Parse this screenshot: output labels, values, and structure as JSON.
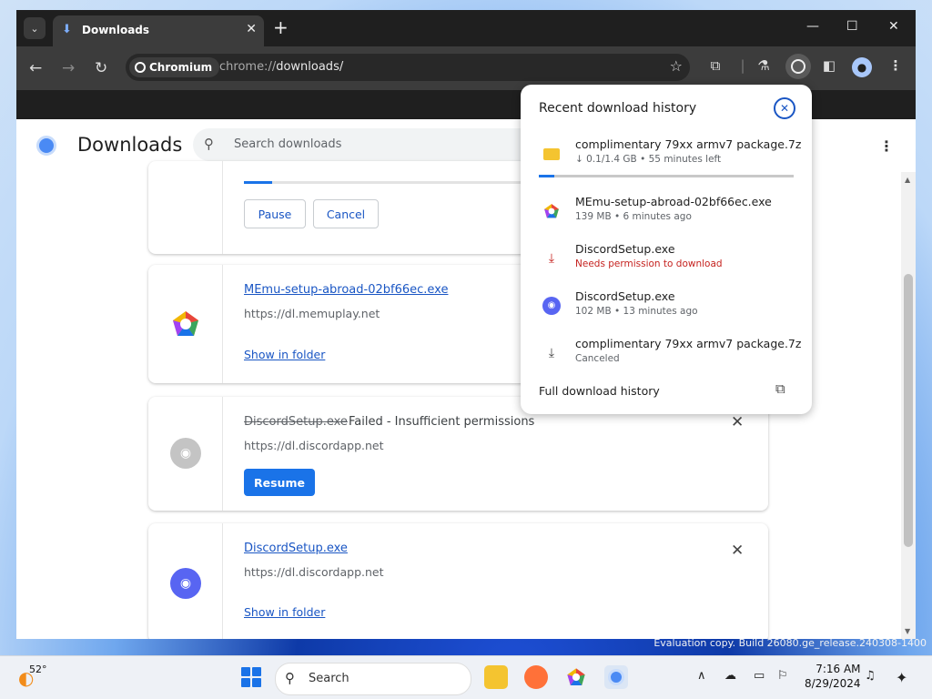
{
  "window": {
    "tab_title": "Downloads",
    "omnibox_chip": "Chromium",
    "url_scheme": "chrome://",
    "url_path": "downloads/"
  },
  "page": {
    "title": "Downloads",
    "search_placeholder": "Search downloads"
  },
  "downloads": [
    {
      "pause_label": "Pause",
      "cancel_label": "Cancel",
      "progress": 0.1
    },
    {
      "filename": "MEmu-setup-abroad-02bf66ec.exe",
      "source": "https://dl.memuplay.net",
      "action": "Show in folder"
    },
    {
      "filename": "DiscordSetup.exe",
      "status": "Failed - Insufficient permissions",
      "source": "https://dl.discordapp.net",
      "action": "Resume"
    },
    {
      "filename": "DiscordSetup.exe",
      "source": "https://dl.discordapp.net",
      "action": "Show in folder"
    }
  ],
  "bubble": {
    "title": "Recent download history",
    "items": [
      {
        "name": "complimentary 79xx armv7 package.7z",
        "sub": "↓ 0.1/1.4 GB • 55 minutes left",
        "progress": 0.06
      },
      {
        "name": "MEmu-setup-abroad-02bf66ec.exe",
        "sub": "139 MB • 6 minutes ago"
      },
      {
        "name": "DiscordSetup.exe",
        "sub": "Needs permission to download"
      },
      {
        "name": "DiscordSetup.exe",
        "sub": "102 MB • 13 minutes ago"
      },
      {
        "name": "complimentary 79xx armv7 package.7z",
        "sub": "Canceled"
      }
    ],
    "footer": "Full download history"
  },
  "desktop": {
    "watermark_line1": "Evaluation copy. Build 26080.ge_release.240308-1400"
  },
  "taskbar": {
    "temperature": "52°",
    "search_label": "Search",
    "time": "7:16 AM",
    "date": "8/29/2024"
  },
  "colors": {
    "accent": "#1a73e8",
    "error": "#c5221f",
    "discord": "#5865f2"
  }
}
